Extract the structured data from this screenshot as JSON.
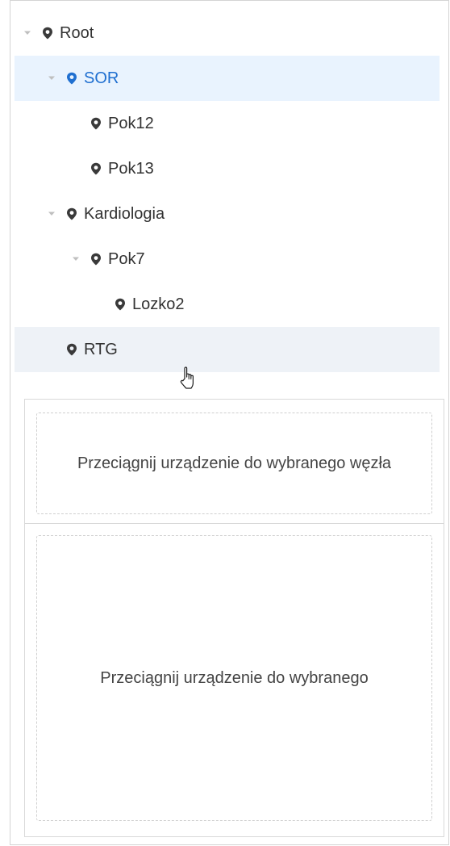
{
  "tree": {
    "nodes": [
      {
        "label": "Root",
        "expanded": true,
        "state": "normal"
      },
      {
        "label": "SOR",
        "expanded": true,
        "state": "selected"
      },
      {
        "label": "Pok12",
        "expanded": null,
        "state": "normal"
      },
      {
        "label": "Pok13",
        "expanded": null,
        "state": "normal"
      },
      {
        "label": "Kardiologia",
        "expanded": true,
        "state": "normal"
      },
      {
        "label": "Pok7",
        "expanded": true,
        "state": "normal"
      },
      {
        "label": "Lozko2",
        "expanded": null,
        "state": "normal"
      },
      {
        "label": "RTG",
        "expanded": null,
        "state": "hovered"
      }
    ],
    "icon": "map-marker-icon"
  },
  "drop_zones": {
    "top_text": "Przeciągnij urządzenie do wybranego węzła",
    "bottom_text": "Przeciągnij urządzenie do wybranego"
  },
  "colors": {
    "selected_bg": "#e9f3fe",
    "selected_text": "#1f6fd0",
    "hover_bg": "#eef2f7",
    "text": "#333333",
    "toggle": "#bfbfbf",
    "border": "#d4d4d4"
  }
}
